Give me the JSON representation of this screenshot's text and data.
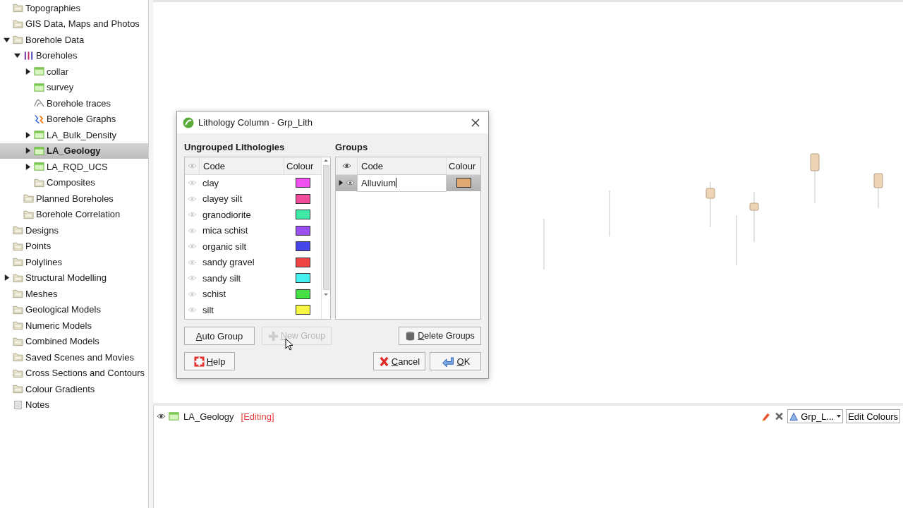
{
  "tree": [
    {
      "label": "Topographies",
      "kind": "folder",
      "selected": false
    },
    {
      "label": "GIS Data, Maps and Photos",
      "kind": "folder",
      "selected": false
    },
    {
      "label": "Borehole Data",
      "kind": "folder",
      "selected": false,
      "expanded": true,
      "children": [
        {
          "label": "Boreholes",
          "kind": "boreholes",
          "selected": false,
          "expanded": true,
          "children": [
            {
              "label": "collar",
              "kind": "table",
              "selected": false,
              "expanded": false
            },
            {
              "label": "survey",
              "kind": "table",
              "selected": false
            },
            {
              "label": "Borehole traces",
              "kind": "traces",
              "selected": false
            },
            {
              "label": "Borehole Graphs",
              "kind": "graphs",
              "selected": false
            },
            {
              "label": "LA_Bulk_Density",
              "kind": "table",
              "selected": false,
              "expanded": false
            },
            {
              "label": "LA_Geology",
              "kind": "table",
              "selected": true,
              "expanded": false
            },
            {
              "label": "LA_RQD_UCS",
              "kind": "table",
              "selected": false,
              "expanded": false
            },
            {
              "label": "Composites",
              "kind": "folder",
              "selected": false
            }
          ]
        },
        {
          "label": "Planned Boreholes",
          "kind": "folder",
          "selected": false
        },
        {
          "label": "Borehole Correlation",
          "kind": "folder",
          "selected": false
        }
      ]
    },
    {
      "label": "Designs",
      "kind": "folder",
      "selected": false
    },
    {
      "label": "Points",
      "kind": "folder",
      "selected": false
    },
    {
      "label": "Polylines",
      "kind": "folder",
      "selected": false
    },
    {
      "label": "Structural Modelling",
      "kind": "folder",
      "selected": false,
      "expanded": false
    },
    {
      "label": "Meshes",
      "kind": "folder",
      "selected": false
    },
    {
      "label": "Geological Models",
      "kind": "folder",
      "selected": false
    },
    {
      "label": "Numeric Models",
      "kind": "folder",
      "selected": false
    },
    {
      "label": "Combined Models",
      "kind": "folder",
      "selected": false
    },
    {
      "label": "Saved Scenes and Movies",
      "kind": "folder",
      "selected": false
    },
    {
      "label": "Cross Sections and Contours",
      "kind": "folder",
      "selected": false
    },
    {
      "label": "Colour Gradients",
      "kind": "folder",
      "selected": false
    },
    {
      "label": "Notes",
      "kind": "notes",
      "selected": false
    }
  ],
  "dialog": {
    "title": "Lithology Column - Grp_Lith",
    "ungrouped": {
      "heading": "Ungrouped Lithologies",
      "columns": [
        "Code",
        "Colour"
      ],
      "rows": [
        {
          "code": "clay",
          "color": "#f050f0"
        },
        {
          "code": "clayey silt",
          "color": "#f04a9a"
        },
        {
          "code": "granodiorite",
          "color": "#40e8a8"
        },
        {
          "code": "mica schist",
          "color": "#9a50f0"
        },
        {
          "code": "organic silt",
          "color": "#4444e8"
        },
        {
          "code": "sandy gravel",
          "color": "#f04444"
        },
        {
          "code": "sandy silt",
          "color": "#44f0f0"
        },
        {
          "code": "schist",
          "color": "#44e044"
        },
        {
          "code": "silt",
          "color": "#f8f844"
        }
      ]
    },
    "groups": {
      "heading": "Groups",
      "columns": [
        "Code",
        "Colour"
      ],
      "rows": [
        {
          "code": "Alluvium",
          "color": "#e0a874",
          "expanded": false,
          "editing": true
        }
      ]
    },
    "action_buttons": [
      {
        "label": "Auto Group",
        "kind": "plain",
        "disabled": false
      },
      {
        "label": "New Group",
        "kind": "add",
        "disabled": true
      },
      {
        "label": "Delete Groups",
        "kind": "delete",
        "disabled": false
      }
    ],
    "footer_buttons": [
      {
        "label": "Help",
        "kind": "help",
        "disabled": false
      },
      {
        "label": "Cancel",
        "kind": "cancel",
        "disabled": false
      },
      {
        "label": "OK",
        "kind": "ok",
        "disabled": false
      }
    ]
  },
  "layer_bar": {
    "name": "LA_Geology",
    "status": "[Editing]",
    "dropdown": "Grp_L...",
    "button": "Edit Colours"
  }
}
